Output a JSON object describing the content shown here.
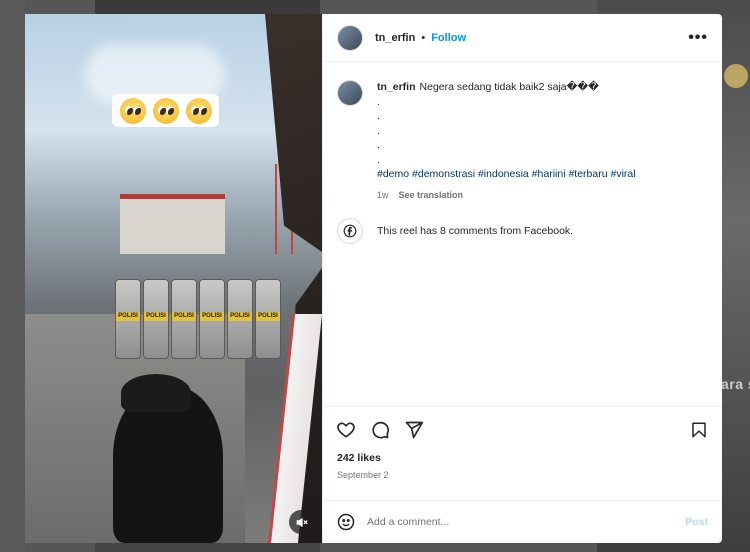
{
  "background": {
    "partial_text": "ara s"
  },
  "media": {
    "overlay_emojis": [
      "pleading-face-emoji",
      "pleading-face-emoji",
      "pleading-face-emoji"
    ],
    "shield_label": "POLISI",
    "mute_icon": "muted-speaker-icon"
  },
  "header": {
    "username": "tn_erfin",
    "separator": "•",
    "follow_label": "Follow",
    "more_label": "•••"
  },
  "caption": {
    "username": "tn_erfin",
    "text": "Negera sedang tidak baik2 saja���",
    "dots": [
      ".",
      ".",
      ".",
      ".",
      "."
    ],
    "hashtags": "#demo #demonstrasi #indonesia #hariini #terbaru #viral",
    "age": "1w",
    "translate_label": "See translation"
  },
  "facebook_notice": {
    "text": "This reel has 8 comments from Facebook."
  },
  "engagement": {
    "likes": "242 likes",
    "date": "September 2"
  },
  "comment_box": {
    "placeholder": "Add a comment...",
    "post_label": "Post"
  },
  "colors": {
    "link_blue": "#0095f6",
    "hashtag_blue": "#00376b",
    "muted_text": "#737373",
    "post_disabled": "#b3dbff"
  }
}
